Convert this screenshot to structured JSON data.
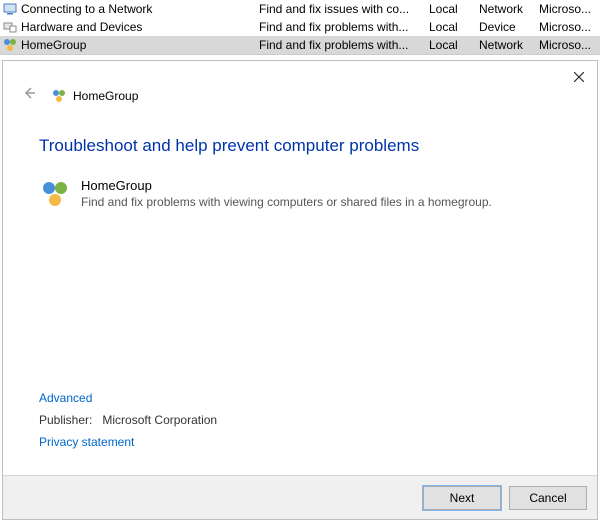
{
  "list": {
    "rows": [
      {
        "name": "Connecting to a Network",
        "desc": "Find and fix issues with co...",
        "loc": "Local",
        "cat": "Network",
        "pub": "Microso..."
      },
      {
        "name": "Hardware and Devices",
        "desc": "Find and fix problems with...",
        "loc": "Local",
        "cat": "Device",
        "pub": "Microso..."
      },
      {
        "name": "HomeGroup",
        "desc": "Find and fix problems with...",
        "loc": "Local",
        "cat": "Network",
        "pub": "Microso..."
      }
    ],
    "selected_index": 2
  },
  "dialog": {
    "breadcrumb": "HomeGroup",
    "title": "Troubleshoot and help prevent computer problems",
    "item": {
      "name": "HomeGroup",
      "desc": "Find and fix problems with viewing computers or shared files in a homegroup."
    },
    "advanced": "Advanced",
    "publisher_label": "Publisher:",
    "publisher_value": "Microsoft Corporation",
    "privacy": "Privacy statement",
    "next": "Next",
    "cancel": "Cancel"
  }
}
